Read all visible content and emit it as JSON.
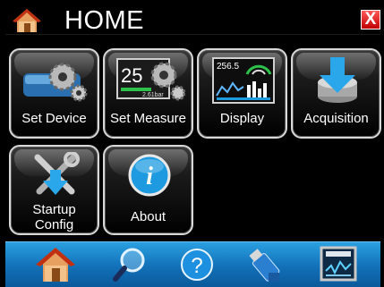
{
  "header": {
    "title": "HOME",
    "close_label": "X"
  },
  "tiles": [
    {
      "label": "Set Device"
    },
    {
      "label": "Set Measure",
      "icon_text": "25",
      "icon_subtext": "2.61bar"
    },
    {
      "label": "Display",
      "icon_text": "256.5"
    },
    {
      "label": "Acquisition"
    },
    {
      "label_line1": "Startup",
      "label_line2": "Config"
    },
    {
      "label": "About",
      "icon_text": "i"
    }
  ],
  "navbar": {
    "icons": [
      "home-icon",
      "search-icon",
      "help-icon",
      "usb-drive-icon",
      "monitor-icon"
    ],
    "help_glyph": "?"
  },
  "colors": {
    "navbar": "#1a84cc",
    "close": "#e02020",
    "accent_blue": "#1e9be0"
  }
}
